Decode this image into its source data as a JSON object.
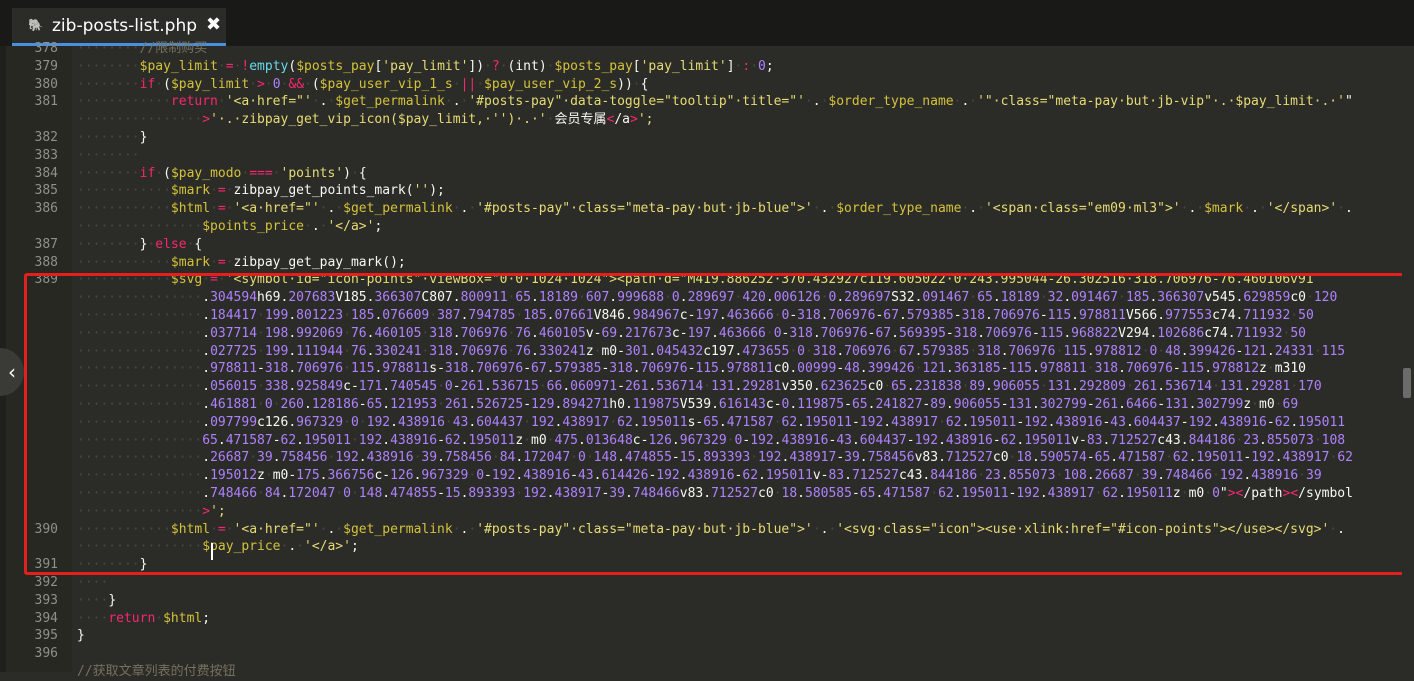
{
  "editor": {
    "tab": {
      "filename": "zib-posts-list.php",
      "close_glyph": "✖",
      "icon": "php-elephant-icon"
    },
    "collapse_glyph": "‹",
    "accent_color": "#4a90e2",
    "highlight_color": "#e3201b",
    "lines": [
      {
        "number": "378",
        "text": "········//限制购买"
      },
      {
        "number": "379",
        "text": "········$pay_limit·=·!empty($posts_pay['pay_limit'])·?·(int)·$posts_pay['pay_limit']·:·0;"
      },
      {
        "number": "380",
        "text": "········if·($pay_limit·>·0·&&·($pay_user_vip_1_s·||·$pay_user_vip_2_s))·{"
      },
      {
        "number": "381",
        "text": "············return·'<a·href=\"'·.·$get_permalink·.·'#posts-pay\"·data-toggle=\"tooltip\"·title=\"'·.·$order_type_name·.·'\"·class=\"meta-pay·but·jb-vip\"·.·$pay_limit·.·'\""
      },
      {
        "number": "",
        "text": "················>'·.·zibpay_get_vip_icon($pay_limit,·'')·.·'·会员专属</a>';"
      },
      {
        "number": "382",
        "text": "········}"
      },
      {
        "number": "383",
        "text": "········"
      },
      {
        "number": "384",
        "text": "········if·($pay_modo·===·'points')·{"
      },
      {
        "number": "385",
        "text": "············$mark·=·zibpay_get_points_mark('');"
      },
      {
        "number": "386",
        "text": "············$html·=·'<a·href=\"'·.·$get_permalink·.·'#posts-pay\"·class=\"meta-pay·but·jb-blue\">'·.·$order_type_name·.·'<span·class=\"em09·ml3\">'·.·$mark·.·'</span>'·."
      },
      {
        "number": "",
        "text": "················$points_price·.·'</a>';"
      },
      {
        "number": "387",
        "text": "········}·else·{"
      },
      {
        "number": "388",
        "text": "············$mark·=·zibpay_get_pay_mark();"
      },
      {
        "number": "389",
        "text": "············$svg·=·'<symbol·id=\"icon-points\"·viewBox=\"0·0·1024·1024\"><path·d=\"M419.886252·370.432927c119.605022·0·243.995044-26.302516·318.706976-76.460106v91"
      },
      {
        "number": "",
        "text": "················.304594h69.207683V185.366307C807.800911·65.18189·607.999688·0.289697·420.006126·0.289697S32.091467·65.18189·32.091467·185.366307v545.629859c0·120"
      },
      {
        "number": "",
        "text": "················.184417·199.801223·185.076609·387.794785·185.07661V846.984967c-197.463666·0-318.706976-67.579385-318.706976-115.978811V566.977553c74.711932·50"
      },
      {
        "number": "",
        "text": "················.037714·198.992069·76.460105·318.706976·76.460105v-69.217673c-197.463666·0-318.706976-67.569395-318.706976-115.968822V294.102686c74.711932·50"
      },
      {
        "number": "",
        "text": "················.027725·199.111944·76.330241·318.706976·76.330241z·m0-301.045432c197.473655·0·318.706976·67.579385·318.706976·115.978812·0·48.399426-121.24331·115"
      },
      {
        "number": "",
        "text": "················.978811-318.706976·115.978811s-318.706976-67.579385-318.706976-115.978811c0.00999-48.399426·121.363185-115.978811·318.706976-115.978812z·m310"
      },
      {
        "number": "",
        "text": "················.056015·338.925849c-171.740545·0-261.536715·66.060971-261.536714·131.29281v350.623625c0·65.231838·89.906055·131.292809·261.536714·131.29281·170"
      },
      {
        "number": "",
        "text": "················.461881·0·260.128186-65.121953·261.526725-129.894271h0.119875V539.616143c-0.119875-65.241827-89.906055-131.302799-261.6466-131.302799z·m0·69"
      },
      {
        "number": "",
        "text": "················.097799c126.967329·0·192.438916·43.604437·192.438917·62.195011s-65.471587·62.195011-192.438917·62.195011-192.438916-43.604437-192.438916-62.195011"
      },
      {
        "number": "",
        "text": "················65.471587-62.195011·192.438916-62.195011z·m0·475.013648c-126.967329·0-192.438916-43.604437-192.438916-62.195011v-83.712527c43.844186·23.855073·108"
      },
      {
        "number": "",
        "text": "················.26687·39.758456·192.438916·39.758456·84.172047·0·148.474855-15.893393·192.438917-39.758456v83.712527c0·18.590574-65.471587·62.195011-192.438917·62"
      },
      {
        "number": "",
        "text": "················.195012z·m0-175.366756c-126.967329·0-192.438916-43.614426-192.438916-62.195011v-83.712527c43.844186·23.855073·108.26687·39.748466·192.438916·39"
      },
      {
        "number": "",
        "text": "················.748466·84.172047·0·148.474855-15.893393·192.438917-39.748466v83.712527c0·18.580585-65.471587·62.195011-192.438917·62.195011z·m0·0\"></path></symbol"
      },
      {
        "number": "",
        "text": "················>';"
      },
      {
        "number": "390",
        "text": "············$html·=·'<a·href=\"'·.·$get_permalink·.·'#posts-pay\"·class=\"meta-pay·but·jb-blue\">'·.·'<svg·class=\"icon\"><use·xlink:href=\"#icon-points\"></use></svg>'·."
      },
      {
        "number": "",
        "text": "················$pay_price·.·'</a>';"
      },
      {
        "number": "391",
        "text": "········}"
      },
      {
        "number": "392",
        "text": "····"
      },
      {
        "number": "393",
        "text": "····}"
      },
      {
        "number": "394",
        "text": "····return·$html;"
      },
      {
        "number": "395",
        "text": "}"
      },
      {
        "number": "396",
        "text": ""
      },
      {
        "number": "",
        "text": "//获取文章列表的付费按钮"
      }
    ]
  }
}
